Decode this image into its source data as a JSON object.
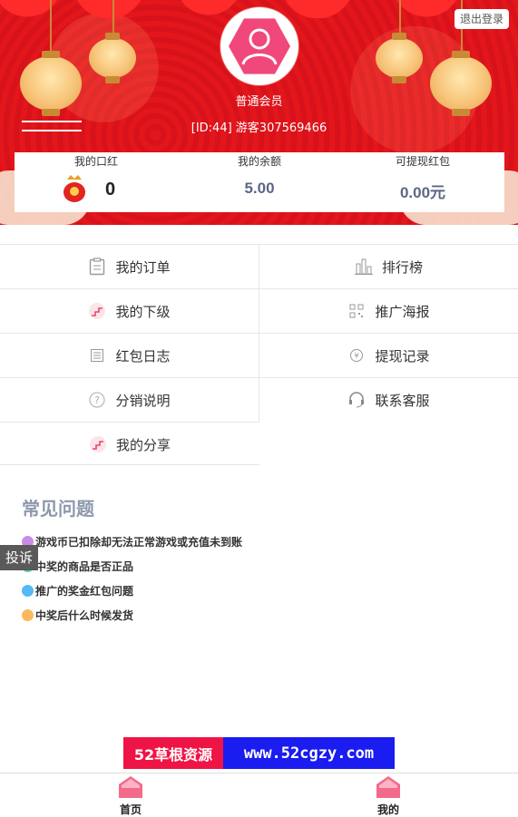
{
  "header": {
    "logout_label": "退出登录",
    "member_level": "普通会员",
    "member_id": "[ID:44] 游客307569466",
    "accent_color": "#e0161c"
  },
  "stats": [
    {
      "label": "我的口红",
      "value": "0"
    },
    {
      "label": "我的余额",
      "value": "5.00"
    },
    {
      "label": "可提现红包",
      "value": "0.00元"
    }
  ],
  "menu": [
    {
      "label": "我的订单",
      "icon": "clipboard-icon"
    },
    {
      "label": "排行榜",
      "icon": "bar-chart-icon"
    },
    {
      "label": "我的下级",
      "icon": "stairs-icon"
    },
    {
      "label": "推广海报",
      "icon": "qr-code-icon"
    },
    {
      "label": "红包日志",
      "icon": "log-icon"
    },
    {
      "label": "提现记录",
      "icon": "yen-coin-icon"
    },
    {
      "label": "分销说明",
      "icon": "question-icon"
    },
    {
      "label": "联系客服",
      "icon": "headset-icon"
    },
    {
      "label": "我的分享",
      "icon": "stairs-icon"
    }
  ],
  "faq": {
    "title": "常见问题",
    "items": [
      {
        "text": "游戏币已扣除却无法正常游戏或充值未到账",
        "color": "#c88ce6"
      },
      {
        "text": "中奖的商品是否正品",
        "color": "#4cd5a0"
      },
      {
        "text": "推广的奖金红包问题",
        "color": "#55b9f5"
      },
      {
        "text": "中奖后什么时候发货",
        "color": "#fbb95f"
      }
    ]
  },
  "complain_label": "投诉",
  "banner": {
    "left": "52草根资源",
    "right": "www.52cgzy.com"
  },
  "tabs": [
    {
      "label": "首页",
      "icon": "home-icon"
    },
    {
      "label": "我的",
      "icon": "home-icon"
    }
  ]
}
